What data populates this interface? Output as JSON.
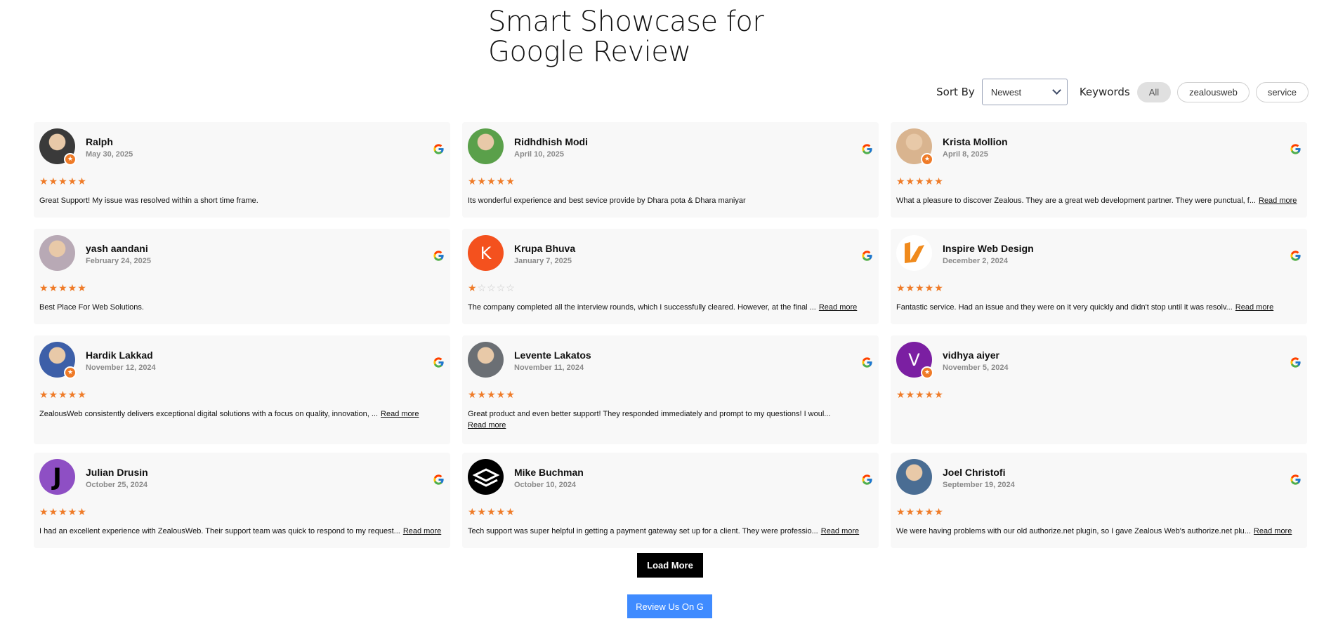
{
  "page": {
    "title_line1": "Smart Showcase for",
    "title_line2": "Google Review"
  },
  "controls": {
    "sort_label": "Sort By",
    "sort_value": "Newest",
    "keywords_label": "Keywords",
    "chips": [
      "All",
      "zealousweb",
      "service"
    ],
    "active_chip": "All"
  },
  "colors": {
    "star": "#ef7b28",
    "load_more_bg": "#000000",
    "review_button_bg": "#3f8bff",
    "card_bg": "#f8f8f8"
  },
  "reviews": [
    {
      "name": "Ralph",
      "date": "May 30, 2025",
      "rating": 5,
      "text": "Great Support! My issue was resolved within a short time frame.",
      "read_more": "",
      "avatar": "photo",
      "avatar_color": "#3a3a3a",
      "initial": "",
      "badge": true
    },
    {
      "name": "Ridhdhish Modi",
      "date": "April 10, 2025",
      "rating": 5,
      "text": "Its wonderful experience and best sevice provide by Dhara pota & Dhara maniyar",
      "read_more": "",
      "avatar": "photo",
      "avatar_color": "#5aa04a",
      "initial": "",
      "badge": false
    },
    {
      "name": "Krista Mollion",
      "date": "April 8, 2025",
      "rating": 5,
      "text": "What a pleasure to discover Zealous. They are a great web development partner. They were punctual, f...",
      "read_more": "Read more",
      "avatar": "photo",
      "avatar_color": "#d9b48f",
      "initial": "",
      "badge": true
    },
    {
      "name": "yash aandani",
      "date": "February 24, 2025",
      "rating": 5,
      "text": "Best Place For Web Solutions.",
      "read_more": "",
      "avatar": "photo",
      "avatar_color": "#b8a9b5",
      "initial": "",
      "badge": false
    },
    {
      "name": "Krupa Bhuva",
      "date": "January 7, 2025",
      "rating": 1,
      "text": "The company completed all the interview rounds, which I successfully cleared. However, at the final ...",
      "read_more": "Read more",
      "avatar": "initial",
      "avatar_color": "#f4511e",
      "initial": "K",
      "badge": false
    },
    {
      "name": "Inspire Web Design",
      "date": "December 2, 2024",
      "rating": 5,
      "text": "Fantastic service. Had an issue and they were on it very quickly and didn't stop until it was resolv...",
      "read_more": "Read more",
      "avatar": "logo",
      "avatar_color": "#f08a1c",
      "initial": "",
      "badge": false
    },
    {
      "name": "Hardik Lakkad",
      "date": "November 12, 2024",
      "rating": 5,
      "text": "ZealousWeb consistently delivers exceptional digital solutions with a focus on quality, innovation, ...",
      "read_more": "Read more",
      "avatar": "photo",
      "avatar_color": "#3d5fa8",
      "initial": "",
      "badge": true
    },
    {
      "name": "Levente Lakatos",
      "date": "November 11, 2024",
      "rating": 5,
      "text": "Great product and even better support! They responded immediately and prompt to my questions! I woul...",
      "read_more": "Read more",
      "avatar": "photo",
      "avatar_color": "#6b6f74",
      "initial": "",
      "badge": false
    },
    {
      "name": "vidhya aiyer",
      "date": "November 5, 2024",
      "rating": 5,
      "text": "",
      "read_more": "",
      "avatar": "initial",
      "avatar_color": "#7b1fa2",
      "initial": "V",
      "badge": true
    },
    {
      "name": "Julian Drusin",
      "date": "October 25, 2024",
      "rating": 5,
      "text": "I had an excellent experience with ZealousWeb. Their support team was quick to respond to my request...",
      "read_more": "Read more",
      "avatar": "initial",
      "avatar_color": "#8e4fc4",
      "initial": "J",
      "badge": false
    },
    {
      "name": "Mike Buchman",
      "date": "October 10, 2024",
      "rating": 5,
      "text": "Tech support was super helpful in getting a payment gateway set up for a client. They were professio...",
      "read_more": "Read more",
      "avatar": "logo",
      "avatar_color": "#000000",
      "initial": "",
      "badge": false
    },
    {
      "name": "Joel Christofi",
      "date": "September 19, 2024",
      "rating": 5,
      "text": "We were having problems with our old authorize.net plugin, so I gave Zealous Web's authorize.net plu...",
      "read_more": "Read more",
      "avatar": "photo",
      "avatar_color": "#4a6d93",
      "initial": "",
      "badge": false
    }
  ],
  "buttons": {
    "load_more": "Load More",
    "review_us": "Review Us On G"
  }
}
